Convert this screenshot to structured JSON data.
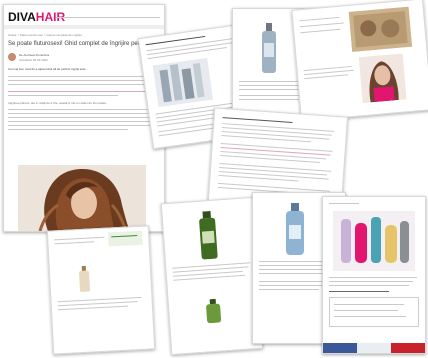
{
  "main_article": {
    "logo_main": "DIVA",
    "logo_accent": "HAIR",
    "breadcrumb": "Acasa > Sfaturi pentru par > Gama completa de ingrijire",
    "headline": "Se poate fluturosexi! Ghid complet de îngrijire pentru cel",
    "author": "De Andreea Florentina",
    "date": "Actualizat 05.03.2023",
    "intro_lead": "Cel mai bun mod de a ajuta părul să fie perfect ingrijit este...",
    "highlight": "Ingrijirea părului, ale în viață de 4 zile, acasă și într-un salon de frumusețe."
  },
  "colors": {
    "brand": "#111111",
    "accent": "#e3166f",
    "link": "#d63a7a",
    "facebook": "#3b5998",
    "pinterest": "#c8232c"
  },
  "share_bar": {
    "items": [
      {
        "icon": "facebook-icon"
      },
      {
        "icon": "twitter-icon"
      },
      {
        "icon": "pinterest-icon"
      }
    ]
  }
}
